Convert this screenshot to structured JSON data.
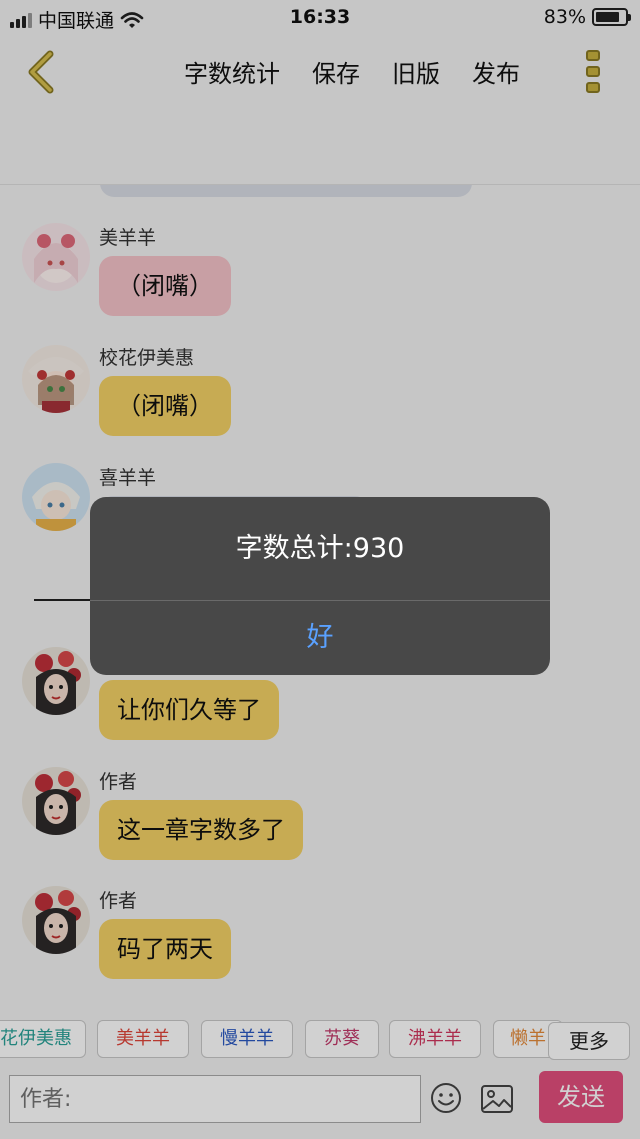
{
  "status_bar": {
    "carrier": "中国联通",
    "time": "16:33",
    "battery_percent": "83%",
    "battery_level": 0.83
  },
  "header": {
    "back_icon": "chevron-left-icon",
    "menu": [
      "字数统计",
      "保存",
      "旧版",
      "发布"
    ],
    "more_icon": "three-square-dots-icon",
    "accent_color": "#c9b13f"
  },
  "chat": {
    "messages": [
      {
        "sender": "美羊羊",
        "text": "（闭嘴）",
        "bubble_color": "#f4c2c8"
      },
      {
        "sender": "校花伊美惠",
        "text": "（闭嘴）",
        "bubble_color": "#f3d166"
      },
      {
        "sender": "喜羊羊",
        "text": "",
        "bubble_color": "#d8dce4"
      },
      {
        "sender": "",
        "text": "让你们久等了",
        "bubble_color": "#f3d166"
      },
      {
        "sender": "作者",
        "text": "这一章字数多了",
        "bubble_color": "#f3d166"
      },
      {
        "sender": "作者",
        "text": "码了两天",
        "bubble_color": "#f3d166"
      }
    ]
  },
  "tags": [
    {
      "label": "花伊美惠",
      "color": "#2aa198"
    },
    {
      "label": "美羊羊",
      "color": "#e0453a"
    },
    {
      "label": "慢羊羊",
      "color": "#2b59c3"
    },
    {
      "label": "苏葵",
      "color": "#c33a6b"
    },
    {
      "label": "沸羊羊",
      "color": "#d1365f"
    },
    {
      "label": "懒羊",
      "color": "#e58a3a"
    }
  ],
  "more_label": "更多",
  "input": {
    "placeholder": "作者:",
    "emoji_icon": "smiley-icon",
    "image_icon": "image-icon",
    "send_label": "发送",
    "send_color": "#e24f7d"
  },
  "dialog": {
    "message": "字数总计:930",
    "ok_label": "好"
  }
}
